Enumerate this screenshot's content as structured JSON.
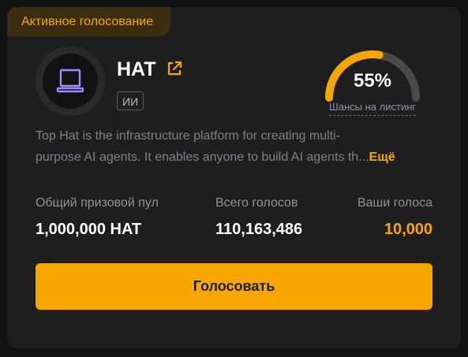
{
  "colors": {
    "background": "#111111",
    "card": "#1e1e1f",
    "accent": "#f7a600",
    "badge_bg": "#3b2e0e",
    "gauge_track": "#4a4a4c",
    "text_primary": "#ffffff",
    "text_secondary": "#8f949c"
  },
  "badge": {
    "label": "Активное голосование"
  },
  "token": {
    "name": "HAT",
    "tag": "ИИ",
    "icon": "laptop-icon",
    "link_icon": "external-link-icon"
  },
  "gauge": {
    "value_text": "55%",
    "fraction": 0.55,
    "label": "Шансы на листинг"
  },
  "description": {
    "line1": "Top Hat is the infrastructure platform for creating multi-",
    "line2": "purpose AI agents. It enables anyone to build AI agents th",
    "more_label": "Ещё"
  },
  "stats": {
    "prize_pool": {
      "label": "Общий призовой пул",
      "value": "1,000,000 HAT"
    },
    "total_votes": {
      "label": "Всего голосов",
      "value": "110,163,486"
    },
    "your_votes": {
      "label": "Ваши голоса",
      "value": "10,000"
    }
  },
  "vote_button": {
    "label": "Голосовать"
  }
}
